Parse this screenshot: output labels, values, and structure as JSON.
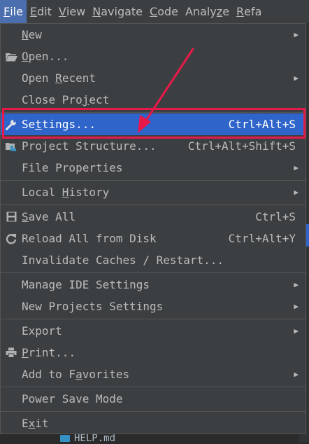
{
  "menubar": {
    "items": [
      {
        "pre": "",
        "mn": "F",
        "post": "ile"
      },
      {
        "pre": "",
        "mn": "E",
        "post": "dit"
      },
      {
        "pre": "",
        "mn": "V",
        "post": "iew"
      },
      {
        "pre": "",
        "mn": "N",
        "post": "avigate"
      },
      {
        "pre": "",
        "mn": "C",
        "post": "ode"
      },
      {
        "pre": "Analy",
        "mn": "z",
        "post": "e"
      },
      {
        "pre": "",
        "mn": "R",
        "post": "efa"
      }
    ]
  },
  "file_menu": {
    "new": {
      "pre": "",
      "mn": "N",
      "post": "ew"
    },
    "open": {
      "pre": "",
      "mn": "O",
      "post": "pen..."
    },
    "open_recent": {
      "pre": "Open ",
      "mn": "R",
      "post": "ecent"
    },
    "close_project": {
      "pre": "Close Pro",
      "mn": "j",
      "post": "ect"
    },
    "settings": {
      "pre": "Se",
      "mn": "t",
      "post": "tings...",
      "shortcut": "Ctrl+Alt+S"
    },
    "project_structure": {
      "label": "Project Structure...",
      "shortcut": "Ctrl+Alt+Shift+S"
    },
    "file_properties": {
      "label": "File Properties"
    },
    "local_history": {
      "pre": "Local ",
      "mn": "H",
      "post": "istory"
    },
    "save_all": {
      "pre": "",
      "mn": "S",
      "post": "ave All",
      "shortcut": "Ctrl+S"
    },
    "reload_all": {
      "label": "Reload All from Disk",
      "shortcut": "Ctrl+Alt+Y"
    },
    "invalidate": {
      "label": "Invalidate Caches / Restart..."
    },
    "manage_ide": {
      "label": "Manage IDE Settings"
    },
    "new_projects": {
      "label": "New Projects Settings"
    },
    "export": {
      "label": "Export"
    },
    "print": {
      "pre": "",
      "mn": "P",
      "post": "rint..."
    },
    "favorites": {
      "pre": "Add to F",
      "mn": "a",
      "post": "vorites"
    },
    "power_save": {
      "label": "Power Save Mode"
    },
    "exit": {
      "pre": "E",
      "mn": "x",
      "post": "it"
    }
  },
  "background": {
    "file_name": "HELP.md"
  },
  "colors": {
    "highlight": "#e8194a",
    "selection": "#2f65ca",
    "menu_bg": "#3c3f41"
  },
  "icons": {
    "open": "folder-icon",
    "settings": "wrench-icon",
    "project_structure": "project-structure-icon",
    "save_all": "floppy-disk-icon",
    "reload_all": "reload-icon",
    "print": "printer-icon",
    "submenu": "chevron-right-icon"
  }
}
